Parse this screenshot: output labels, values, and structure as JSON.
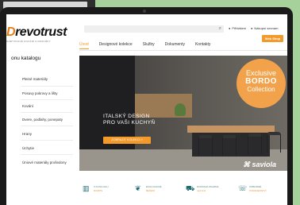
{
  "brand": {
    "logo_prefix": "D",
    "logo_rest": "revotrust",
    "tagline": "NÁBYTKOVÉ KOVÁNÍ A DOPLŇKY"
  },
  "header": {
    "search_icon": "search-icon",
    "util_left": "Přihlášení",
    "util_right": "Nákupní seznam",
    "eshop_button": "Web Shop"
  },
  "nav": {
    "items": [
      "Úvod",
      "Designové kolekce",
      "Služby",
      "Dokumenty",
      "Kontakty"
    ]
  },
  "sidebar": {
    "title": "onu katalogu",
    "items": [
      "Pleiné materiály",
      "Posuvy pokrovy a lišty",
      "Kování",
      "Dvere, podlahy, ponepaty",
      "Hrany",
      "Úchytie",
      "Úniové materiály prošedony"
    ]
  },
  "hero": {
    "line1": "ITALSKÝ DESIGN",
    "line2": "PRO VAŠI KUCHYŇ",
    "button": "ZOBRAZIT KOLEKCI »",
    "badge_line1": "Exclusive",
    "badge_line2": "BORDO",
    "badge_line3": "Collection",
    "brand": "saviola"
  },
  "features": [
    {
      "icon": "book-icon",
      "line1": "Z KATALOGU",
      "line2": "ROZPIS"
    },
    {
      "icon": "leaf-icon",
      "line1": "EKOLOGICKÉ",
      "line2": "ŘEŠENÍ"
    },
    {
      "icon": "truck-icon",
      "line1": "DOPRAVA ZDARMA",
      "line2": "nad limit"
    },
    {
      "icon": "chat-icon",
      "line1": "ODBORNÉ",
      "line2": "PORADENSTVÍ"
    }
  ],
  "colors": {
    "accent": "#f39a2b",
    "teal": "#1f6a6d",
    "background": "#a6d19a",
    "bezel": "#1a1a1a"
  }
}
